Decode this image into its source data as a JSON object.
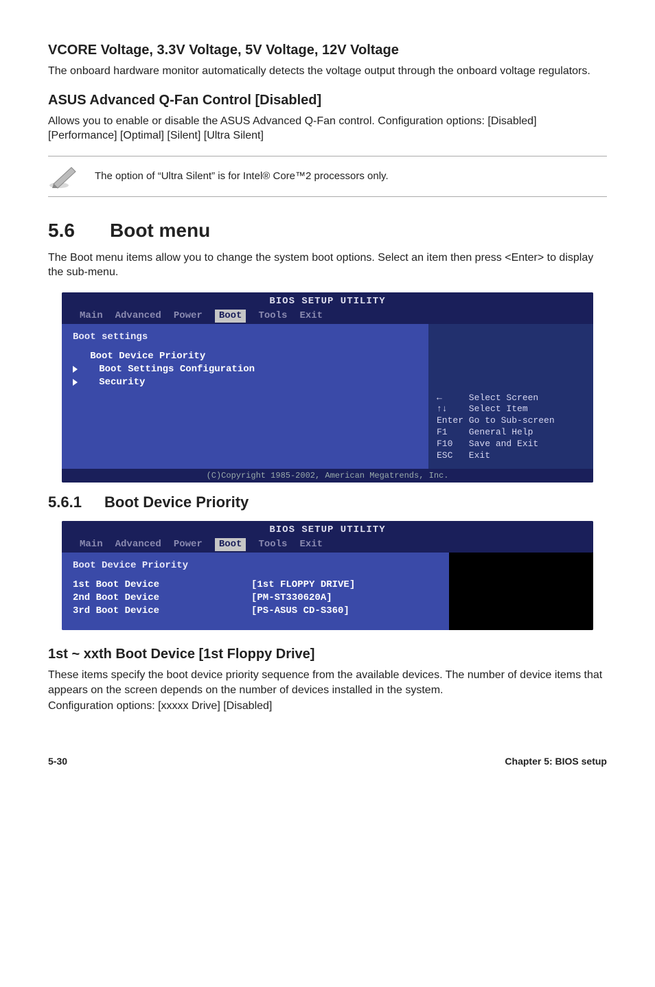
{
  "s1": {
    "h": "VCORE Voltage, 3.3V Voltage, 5V Voltage, 12V Voltage",
    "p": "The onboard hardware monitor automatically detects the voltage output through the onboard voltage regulators."
  },
  "s2": {
    "h": "ASUS Advanced Q-Fan Control [Disabled]",
    "p": "Allows you to enable or disable the ASUS Advanced Q-Fan control. Configuration options: [Disabled] [Performance] [Optimal] [Silent] [Ultra Silent]"
  },
  "note": "The option of “Ultra Silent” is for Intel® Core™2 processors only.",
  "sec": {
    "num": "5.6",
    "title": "Boot menu",
    "p": "The Boot menu items allow you to change the system boot options. Select an item then press <Enter> to display the sub-menu."
  },
  "bios1": {
    "title": "BIOS SETUP UTILITY",
    "tabs": [
      "Main",
      "Advanced",
      "Power",
      "Boot",
      "Tools",
      "Exit"
    ],
    "active_tab": "Boot",
    "left_header": "Boot settings",
    "items": [
      "   Boot Device Priority",
      "",
      "   Boot Settings Configuration",
      "   Security"
    ],
    "help": [
      "←     Select Screen",
      "↑↓    Select Item",
      "Enter Go to Sub-screen",
      "F1    General Help",
      "F10   Save and Exit",
      "ESC   Exit"
    ],
    "copyright": "(C)Copyright 1985-2002, American Megatrends, Inc."
  },
  "sub": {
    "num": "5.6.1",
    "title": "Boot Device Priority"
  },
  "bios2": {
    "title": "BIOS SETUP UTILITY",
    "tabs": [
      "Main",
      "Advanced",
      "Power",
      "Boot",
      "Tools",
      "Exit"
    ],
    "active_tab": "Boot",
    "left_header": "Boot Device Priority",
    "rows": [
      {
        "k": "1st Boot Device",
        "v": "[1st FLOPPY DRIVE]"
      },
      {
        "k": "2nd Boot Device",
        "v": "[PM-ST330620A]"
      },
      {
        "k": "3rd Boot Device",
        "v": "[PS-ASUS CD-S360]"
      }
    ]
  },
  "s3": {
    "h": "1st ~ xxth Boot Device [1st Floppy Drive]",
    "p1": "These items specify the boot device priority sequence from the available devices. The number of device items that appears on the screen depends on the number of devices installed in the system.",
    "p2": "Configuration options: [xxxxx Drive] [Disabled]"
  },
  "footer": {
    "left": "5-30",
    "right": "Chapter 5: BIOS setup"
  }
}
